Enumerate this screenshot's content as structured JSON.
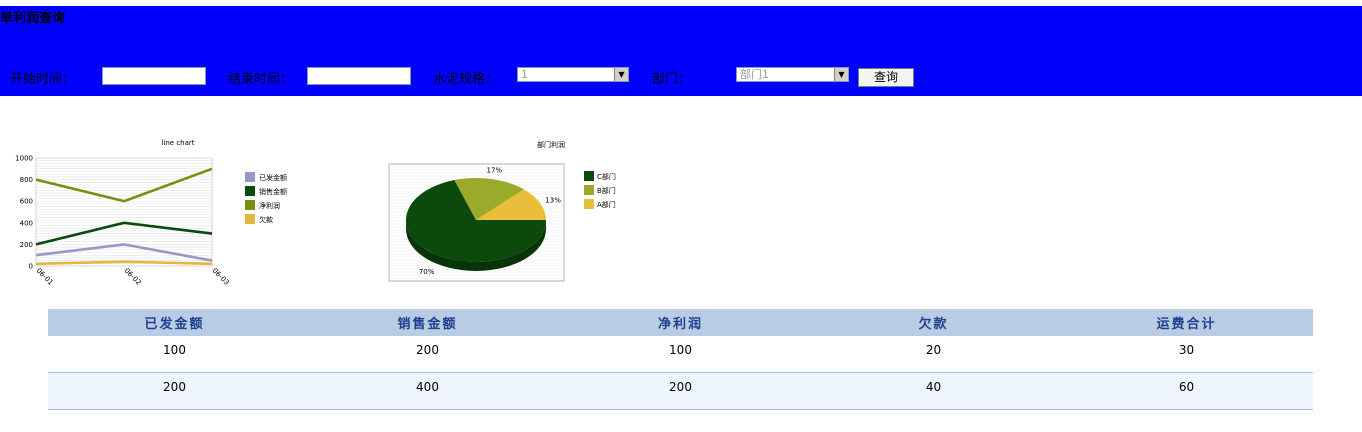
{
  "header": {
    "title": "单利润查询",
    "start_label": "开始时间：",
    "end_label": "结束时间：",
    "spec_label": "水泥规格：",
    "spec_value": "1",
    "dept_label": "部门：",
    "dept_value": "部门1",
    "query_label": "查询",
    "bg_color": "#0000ff"
  },
  "line_chart": {
    "title": "line chart"
  },
  "pie_chart": {
    "title": "部门利润"
  },
  "chart_data": [
    {
      "type": "line",
      "title": "line chart",
      "x": [
        "06-01",
        "06-02",
        "06-03"
      ],
      "ylim": [
        0,
        1000
      ],
      "yticks": [
        0,
        200,
        400,
        600,
        800,
        1000
      ],
      "series": [
        {
          "name": "已发金额",
          "values": [
            100,
            200,
            50
          ],
          "color": "#9a96c8"
        },
        {
          "name": "销售金额",
          "values": [
            200,
            400,
            300
          ],
          "color": "#0b4a0b"
        },
        {
          "name": "净利润",
          "values": [
            800,
            600,
            900
          ],
          "color": "#7a8f10"
        },
        {
          "name": "欠款",
          "values": [
            20,
            40,
            20
          ],
          "color": "#e3b73a"
        }
      ],
      "legend": "right",
      "grid": true
    },
    {
      "type": "pie",
      "title": "部门利润",
      "slices": [
        {
          "name": "C部门",
          "value": 70,
          "label": "70%",
          "color": "#0b4a0b"
        },
        {
          "name": "B部门",
          "value": 17,
          "label": "17%",
          "color": "#9aaa2a"
        },
        {
          "name": "A部门",
          "value": 13,
          "label": "13%",
          "color": "#e8be3a"
        }
      ],
      "legend": "right"
    }
  ],
  "table": {
    "headers": [
      "已发金额",
      "销售金额",
      "净利润",
      "欠款",
      "运费合计"
    ],
    "rows": [
      [
        "100",
        "200",
        "100",
        "20",
        "30"
      ],
      [
        "200",
        "400",
        "200",
        "40",
        "60"
      ]
    ]
  }
}
